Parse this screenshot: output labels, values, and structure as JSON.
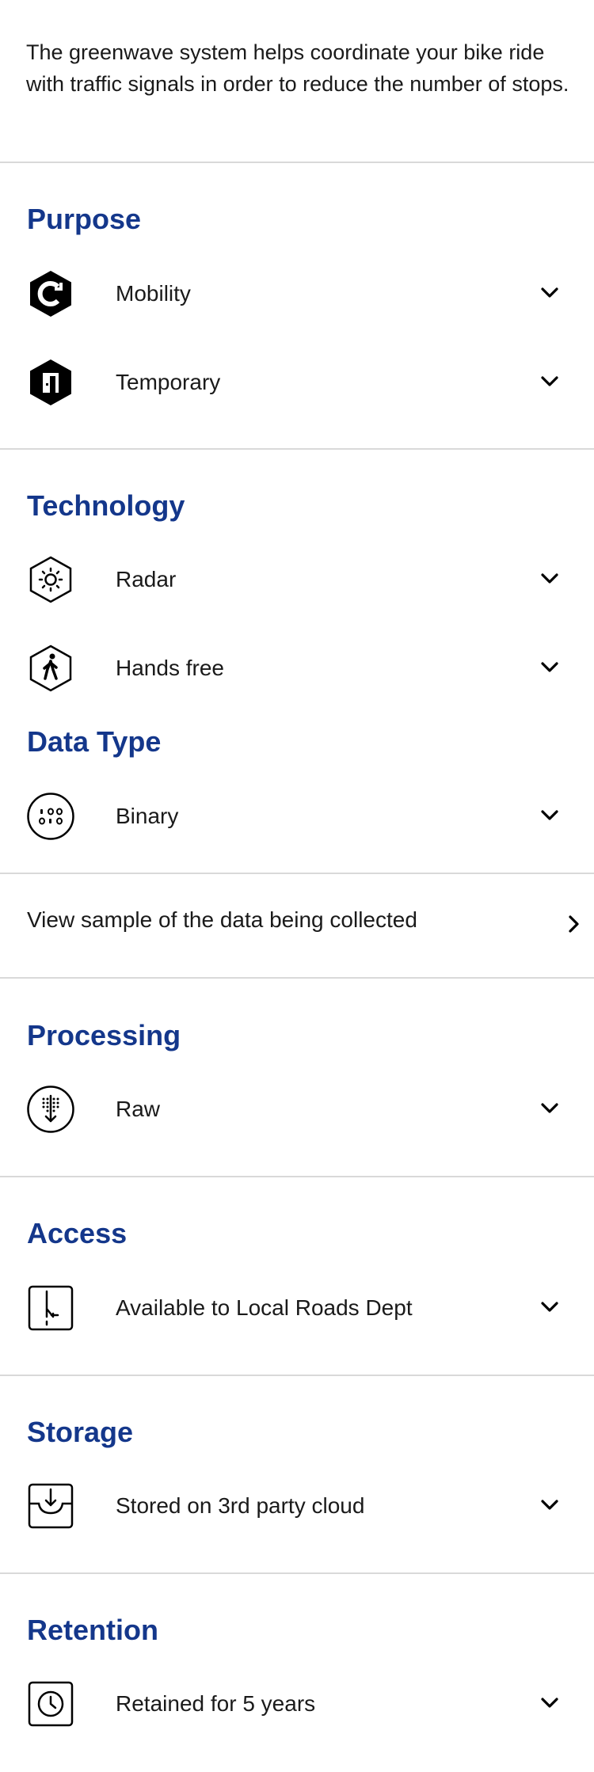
{
  "intro": "The greenwave system helps coordinate your bike ride with traffic signals in order to reduce the number of stops.",
  "sections": {
    "purpose": {
      "title": "Purpose",
      "items": [
        {
          "label": "Mobility",
          "icon": "mobility-hex-icon"
        },
        {
          "label": "Temporary",
          "icon": "door-hex-icon"
        }
      ]
    },
    "technology": {
      "title": "Technology",
      "items": [
        {
          "label": "Radar",
          "icon": "radar-hex-icon"
        },
        {
          "label": "Hands free",
          "icon": "walking-person-hex-icon"
        }
      ]
    },
    "data_type": {
      "title": "Data Type",
      "items": [
        {
          "label": "Binary",
          "icon": "binary-circle-icon"
        }
      ]
    },
    "sample_link": "View sample of the data being collected",
    "processing": {
      "title": "Processing",
      "items": [
        {
          "label": "Raw",
          "icon": "raw-data-circle-icon"
        }
      ]
    },
    "access": {
      "title": "Access",
      "items": [
        {
          "label": "Available to Local Roads Dept",
          "icon": "access-square-icon"
        }
      ]
    },
    "storage": {
      "title": "Storage",
      "items": [
        {
          "label": "Stored on 3rd party cloud",
          "icon": "inbox-square-icon"
        }
      ]
    },
    "retention": {
      "title": "Retention",
      "items": [
        {
          "label": "Retained for 5 years",
          "icon": "clock-square-icon"
        }
      ]
    }
  },
  "colors": {
    "heading": "#14378b",
    "text": "#1a1a1a",
    "divider": "#d9d9d9",
    "icon": "#000000"
  }
}
